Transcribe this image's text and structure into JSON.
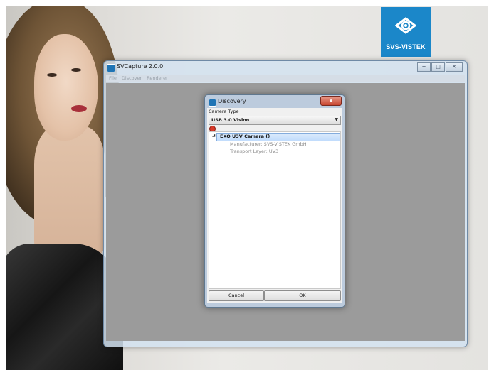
{
  "brand": {
    "logo_text": "SVS-VISTEK",
    "color": "#1b87c9"
  },
  "app_window": {
    "title": "SVCapture 2.0.0",
    "icon": "app-icon",
    "caption_buttons": {
      "minimize": "minimize-icon",
      "maximize": "maximize-icon",
      "close": "close-icon"
    },
    "menu": [
      "File",
      "Discover",
      "Renderer"
    ],
    "client_color": "#9b9b9b"
  },
  "discovery_dialog": {
    "title": "Discovery",
    "close_glyph": "x",
    "camera_type_label": "Camera Type",
    "camera_type_value": "USB 3.0 Vision",
    "refresh_icon": "refresh-icon",
    "tree": {
      "camera": "EXO U3V Camera ()",
      "manufacturer": "Manufacturer: SVS-VISTEK GmbH",
      "transport": "Transport Layer: UV3"
    },
    "buttons": {
      "cancel": "Cancel",
      "ok": "OK"
    }
  }
}
